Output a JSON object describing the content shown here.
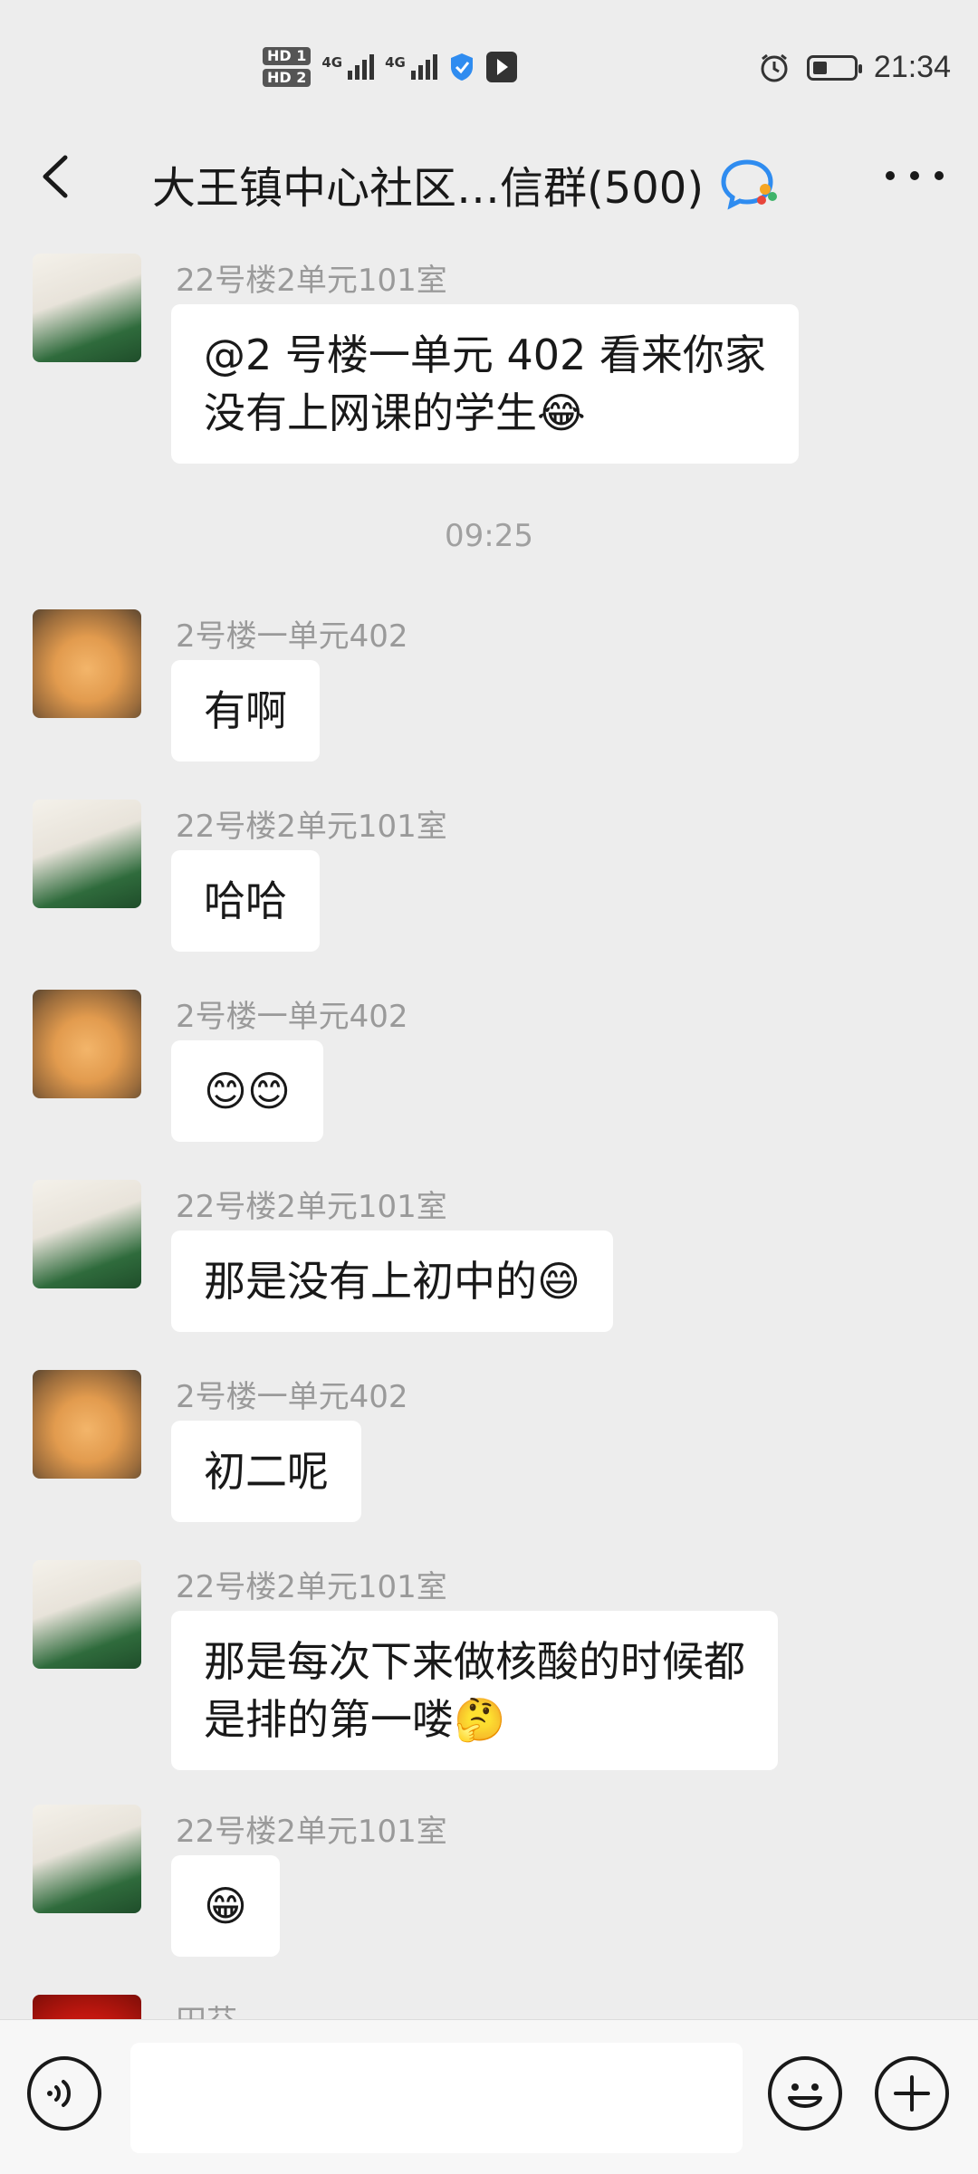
{
  "status_bar": {
    "hd1": "HD 1",
    "hd2": "HD 2",
    "net1": "4G",
    "net2": "4G",
    "battery_level": 0.35,
    "time": "21:34"
  },
  "header": {
    "title": "大王镇中心社区…信群(500)",
    "back_icon": "chevron-left-icon",
    "group_icon": "wecom-group-icon",
    "more_icon": "more-dots-icon"
  },
  "messages": [
    {
      "sender": "22号楼2单元101室",
      "avatar": "people",
      "lines": [
        "@2 号楼一单元 402  看来你家",
        "没有上网课的学生😂"
      ]
    },
    {
      "sender": "2号楼一单元402",
      "avatar": "cat",
      "lines": [
        "有啊"
      ]
    },
    {
      "sender": "22号楼2单元101室",
      "avatar": "people",
      "lines": [
        "哈哈"
      ]
    },
    {
      "sender": "2号楼一单元402",
      "avatar": "cat",
      "lines": [
        "😊😊"
      ]
    },
    {
      "sender": "22号楼2单元101室",
      "avatar": "people",
      "lines": [
        "那是没有上初中的😄"
      ]
    },
    {
      "sender": "2号楼一单元402",
      "avatar": "cat",
      "lines": [
        "初二呢"
      ]
    },
    {
      "sender": "22号楼2单元101室",
      "avatar": "people",
      "lines": [
        "那是每次下来做核酸的时候都",
        "是排的第一喽🤔"
      ]
    },
    {
      "sender": "22号楼2单元101室",
      "avatar": "people",
      "lines": [
        "😁"
      ]
    },
    {
      "sender": "田芬",
      "avatar": "apple",
      "lines": []
    }
  ],
  "timestamp": "09:25",
  "input_bar": {
    "voice_icon": "voice-icon",
    "emoji_icon": "emoji-icon",
    "plus_icon": "plus-icon",
    "input_value": ""
  }
}
